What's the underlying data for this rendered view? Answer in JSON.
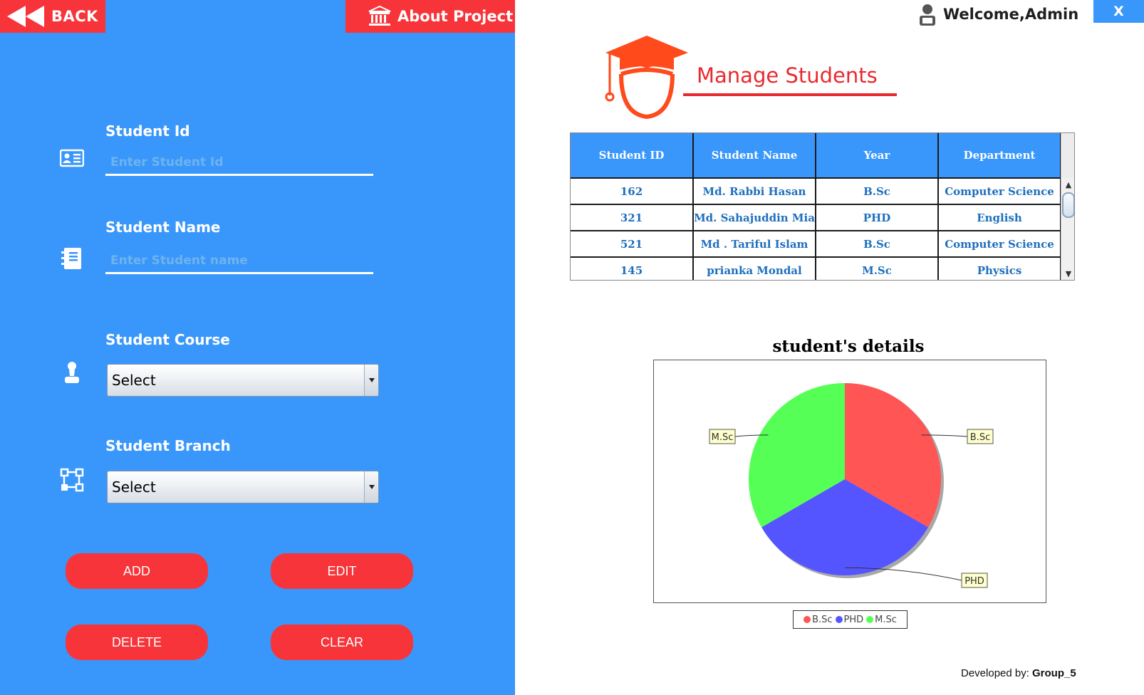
{
  "nav": {
    "back_label": "BACK",
    "about_label": "About Project"
  },
  "header": {
    "welcome_text": "Welcome,Admin",
    "close_label": "X"
  },
  "form": {
    "student_id": {
      "label": "Student Id",
      "placeholder": "Enter Student Id",
      "value": ""
    },
    "student_name": {
      "label": "Student Name",
      "placeholder": "Enter Student name",
      "value": ""
    },
    "student_course": {
      "label": "Student Course",
      "selected": "Select"
    },
    "student_branch": {
      "label": "Student Branch",
      "selected": "Select"
    }
  },
  "actions": {
    "add": "ADD",
    "edit": "EDIT",
    "delete": "DELETE",
    "clear": "CLEAR"
  },
  "page": {
    "title": "Manage Students"
  },
  "table": {
    "columns": [
      "Student ID",
      "Student Name",
      "Year",
      "Department"
    ],
    "rows": [
      [
        "162",
        "Md. Rabbi Hasan",
        "B.Sc",
        "Computer Science"
      ],
      [
        "321",
        "Md. Sahajuddin Mia",
        "PHD",
        "English"
      ],
      [
        "521",
        "Md . Tariful Islam",
        "B.Sc",
        "Computer Science"
      ],
      [
        "145",
        "prianka Mondal",
        "M.Sc",
        "Physics"
      ]
    ]
  },
  "chart_data": {
    "type": "pie",
    "title": "student's details",
    "slices": [
      {
        "label": "B.Sc",
        "value": 33.3,
        "color": "#ff5555"
      },
      {
        "label": "PHD",
        "value": 33.3,
        "color": "#5555ff"
      },
      {
        "label": "M.Sc",
        "value": 33.3,
        "color": "#55ff55"
      }
    ],
    "legend": [
      "B.Sc",
      "PHD",
      "M.Sc"
    ],
    "legend_position": "bottom"
  },
  "footer": {
    "dev_label": "Developed by:",
    "dev_group": "Group_5"
  },
  "colors": {
    "panel_blue": "#3997fb",
    "accent_red": "#f7343a",
    "title_red": "#e9292f",
    "cell_text": "#1f6fbd"
  },
  "icons": {
    "back": "rewind-icon",
    "about": "bank-icon",
    "user": "user-icon",
    "student_id": "id-card-icon",
    "student_name": "notebook-icon",
    "student_course": "person-icon",
    "student_branch": "network-icon",
    "logo": "graduate-cap-icon"
  }
}
